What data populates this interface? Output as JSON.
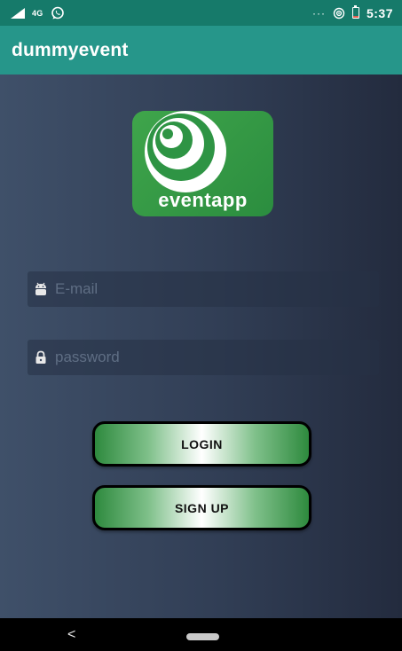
{
  "status_bar": {
    "network": "4G",
    "time": "5:37",
    "overflow_dots": "···",
    "battery_level": 0.2
  },
  "app_bar": {
    "title": "dummyevent"
  },
  "logo": {
    "text": "eventapp"
  },
  "form": {
    "email": {
      "value": "",
      "placeholder": "E-mail",
      "icon": "android-icon"
    },
    "password": {
      "value": "",
      "placeholder": "password",
      "icon": "lock-icon"
    }
  },
  "buttons": {
    "login": "LOGIN",
    "signup": "SIGN UP"
  },
  "nav_bar": {
    "back_glyph": "<"
  },
  "colors": {
    "status_bar": "#167a6a",
    "app_bar": "#26968a",
    "logo_green": "#3fa54b",
    "button_green": "#2e8a3e"
  }
}
